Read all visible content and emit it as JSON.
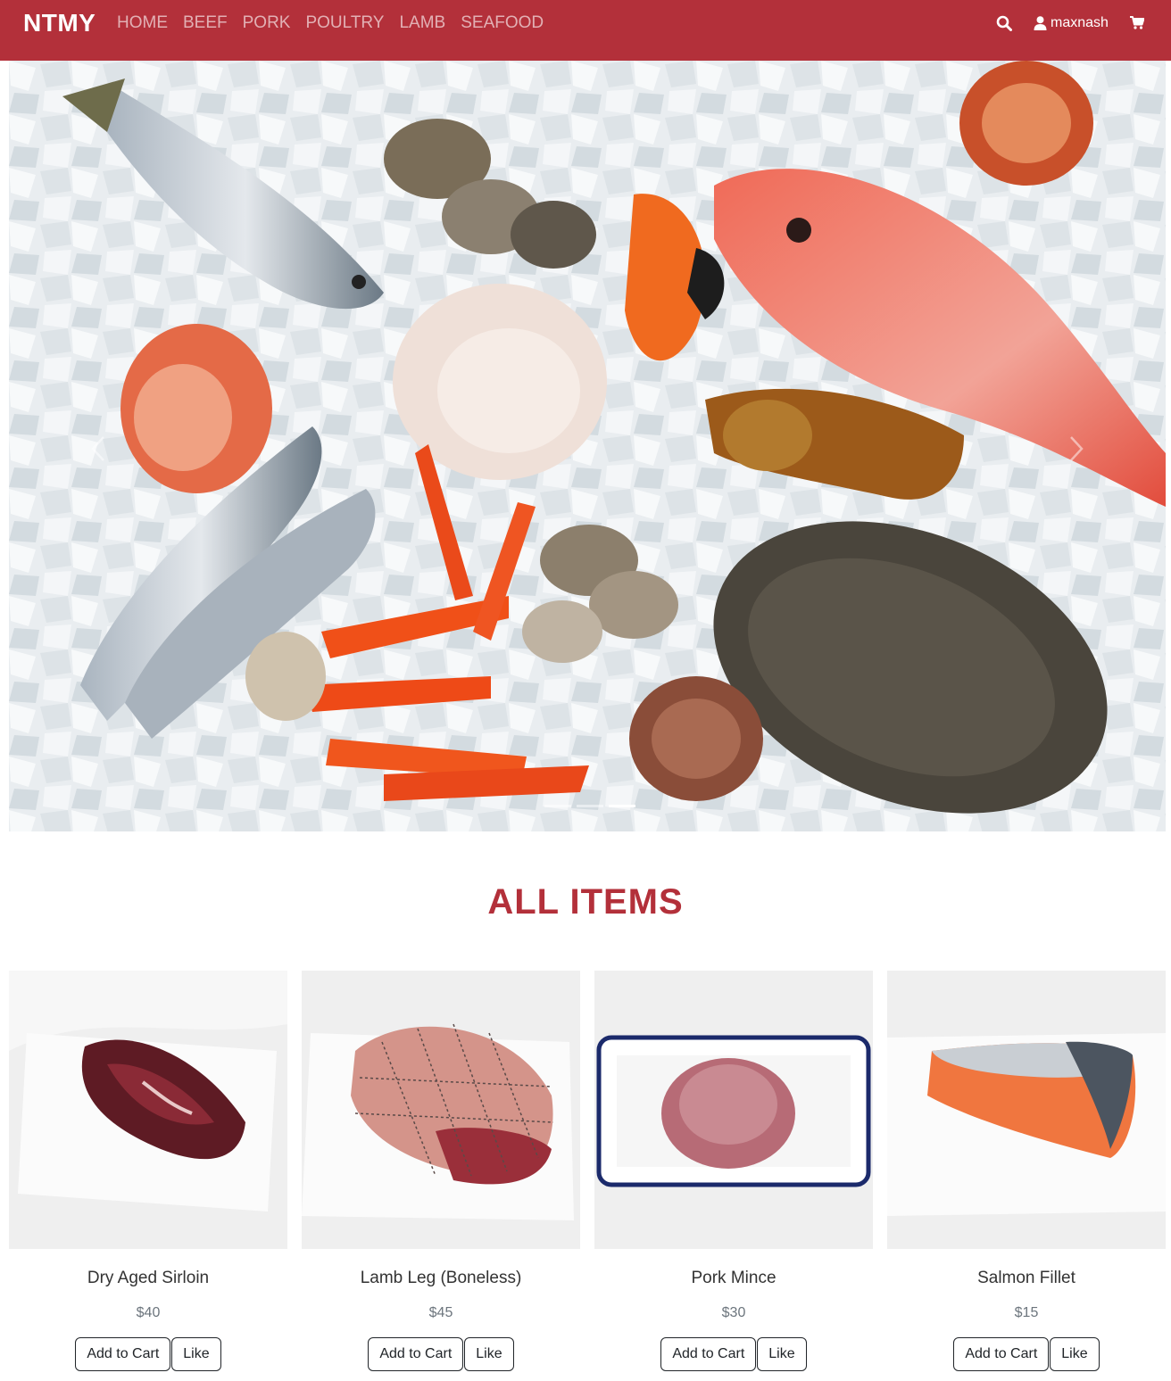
{
  "navbar": {
    "brand": "NTMY",
    "links": [
      "HOME",
      "BEEF",
      "PORK",
      "POULTRY",
      "LAMB",
      "SEAFOOD"
    ],
    "username": "maxnash",
    "icons": [
      "search-icon",
      "user-icon",
      "cart-icon"
    ],
    "color": "#b3303a"
  },
  "hero": {
    "slides": 3,
    "active_slide": 3
  },
  "section": {
    "title": "ALL ITEMS"
  },
  "products": [
    {
      "name": "Dry Aged Sirloin",
      "price": "$40",
      "add_label": "Add to Cart",
      "like_label": "Like"
    },
    {
      "name": "Lamb Leg (Boneless)",
      "price": "$45",
      "add_label": "Add to Cart",
      "like_label": "Like"
    },
    {
      "name": "Pork Mince",
      "price": "$30",
      "add_label": "Add to Cart",
      "like_label": "Like"
    },
    {
      "name": "Salmon Fillet",
      "price": "$15",
      "add_label": "Add to Cart",
      "like_label": "Like"
    }
  ]
}
